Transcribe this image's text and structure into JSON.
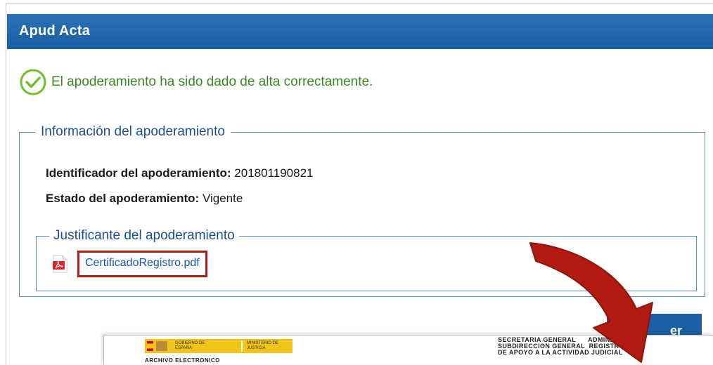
{
  "window": {
    "title": "Apud Acta"
  },
  "success": {
    "message": "El apoderamiento ha sido dado de alta correctamente.",
    "icon": "check-circle-icon",
    "color": "#3a8a1f"
  },
  "info": {
    "legend": "Información del apoderamiento",
    "identifier_label": "Identificador del apoderamiento:",
    "identifier_value": "201801190821",
    "status_label": "Estado del apoderamiento:",
    "status_value": "Vigente"
  },
  "justificante": {
    "legend": "Justificante del apoderamiento",
    "file_icon": "pdf-icon",
    "file_name": "CertificadoRegistro.pdf"
  },
  "button": {
    "label_visible": "er"
  },
  "document_preview": {
    "logo_text_1": "GOBIERNO DE ESPAÑA",
    "logo_text_2": "MINISTERIO DE JUSTICIA",
    "archivo": "ARCHIVO ELECTRONICO",
    "secretaria_lines": "SECRETARIA GENERAL      ADMINIST\nSUBDIRECCION GENERAL  REGISTRO\nDE APOYO A LA ACTIVIDAD JUDICIAL"
  },
  "colors": {
    "header": "#1a5ea3",
    "legend": "#1c4f8f",
    "highlight": "#b31b1b",
    "link": "#1a56a8",
    "arrow": "#b01a10"
  }
}
